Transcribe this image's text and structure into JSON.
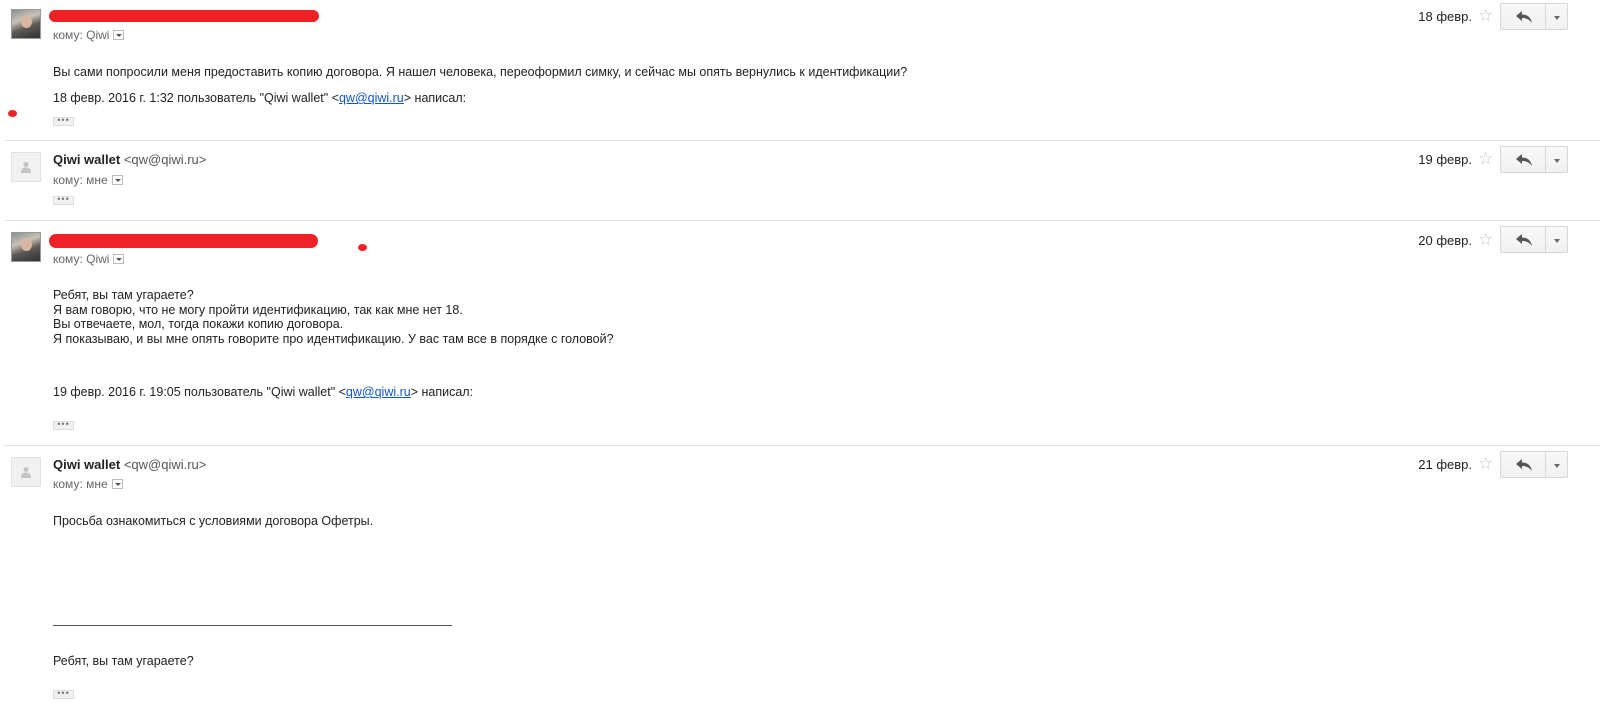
{
  "messages": [
    {
      "recipient_prefix": "кому:",
      "recipient": "Qiwi",
      "date": "18 февр.",
      "body": "Вы сами попросили меня предоставить копию договора. Я нашел человека, переоформил симку, и сейчас мы опять вернулись к идентификации?",
      "quote_prefix": "18 февр. 2016 г. 1:32 пользователь \"Qiwi wallet\" <",
      "quote_email": "qw@qiwi.ru",
      "quote_suffix": "> написал:",
      "ellipsis": "•••"
    },
    {
      "sender_name": "Qiwi wallet",
      "sender_email": "<qw@qiwi.ru>",
      "recipient_prefix": "кому:",
      "recipient": "мне",
      "date": "19 февр.",
      "ellipsis": "•••"
    },
    {
      "recipient_prefix": "кому:",
      "recipient": "Qiwi",
      "date": "20 февр.",
      "body_lines": [
        "Ребят, вы там угараете?",
        "Я вам говорю, что не могу пройти идентификацию, так как мне нет 18.",
        "Вы отвечаете, мол, тогда покажи копию договора.",
        "Я показываю, и вы мне опять говорите про идентификацию. У вас там все в порядке с головой?"
      ],
      "quote_prefix": "19 февр. 2016 г. 19:05 пользователь \"Qiwi wallet\" <",
      "quote_email": "qw@qiwi.ru",
      "quote_suffix": "> написал:",
      "ellipsis": "•••"
    },
    {
      "sender_name": "Qiwi wallet",
      "sender_email": "<qw@qiwi.ru>",
      "recipient_prefix": "кому:",
      "recipient": "мне",
      "date": "21 февр.",
      "body": "Просьба ознакомиться с условиями договора Офетры.",
      "body_after_rule": "Ребят, вы там угараете?",
      "ellipsis": "•••"
    }
  ],
  "icons": {
    "star": "star-icon",
    "reply": "reply-arrow-icon",
    "more": "chevron-down-icon",
    "avatar_placeholder": "person-icon"
  },
  "colors": {
    "redaction": "#ee2126",
    "link": "#1155cc",
    "divider": "#e5e5e5"
  }
}
